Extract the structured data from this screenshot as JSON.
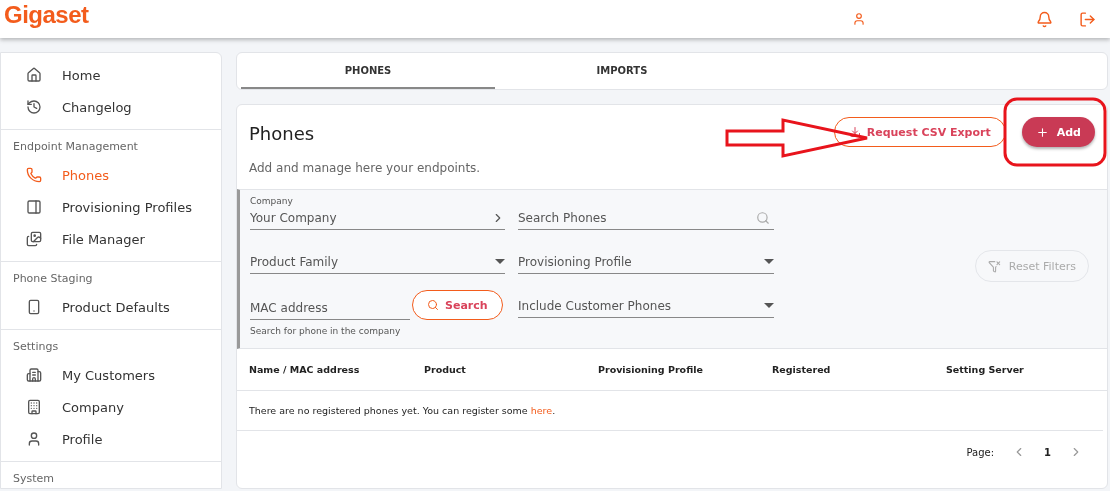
{
  "header": {
    "logo": "Gigaset"
  },
  "sidebar": {
    "sections": [
      {
        "items": [
          {
            "label": "Home",
            "selected": false
          },
          {
            "label": "Changelog",
            "selected": false
          }
        ]
      },
      {
        "title": "Endpoint Management",
        "items": [
          {
            "label": "Phones",
            "selected": true
          },
          {
            "label": "Provisioning Profiles",
            "selected": false
          },
          {
            "label": "File Manager",
            "selected": false
          }
        ]
      },
      {
        "title": "Phone Staging",
        "items": [
          {
            "label": "Product Defaults",
            "selected": false
          }
        ]
      },
      {
        "title": "Settings",
        "items": [
          {
            "label": "My Customers",
            "selected": false
          },
          {
            "label": "Company",
            "selected": false
          },
          {
            "label": "Profile",
            "selected": false
          }
        ]
      },
      {
        "title": "System"
      }
    ]
  },
  "tabs": [
    {
      "label": "PHONES",
      "selected": true
    },
    {
      "label": "IMPORTS",
      "selected": false
    }
  ],
  "card": {
    "title": "Phones",
    "subtitle": "Add and manage here your endpoints.",
    "export_button": "Request CSV Export",
    "add_button": "Add"
  },
  "filters": {
    "company_label": "Company",
    "company_value": "Your Company",
    "search_placeholder": "Search Phones",
    "product_family": "Product Family",
    "provisioning_profile": "Provisioning Profile",
    "mac_placeholder": "MAC address",
    "mac_hint": "Search for phone in the company",
    "search_button": "Search",
    "include_customers": "Include Customer Phones",
    "reset_button": "Reset Filters"
  },
  "table": {
    "columns": [
      "Name / MAC address",
      "Product",
      "Provisioning Profile",
      "Registered",
      "Setting Server"
    ],
    "empty_text": "There are no registered phones yet. You can register some ",
    "empty_link": "here",
    "empty_end": "."
  },
  "pagination": {
    "label": "Page:",
    "page": "1"
  }
}
